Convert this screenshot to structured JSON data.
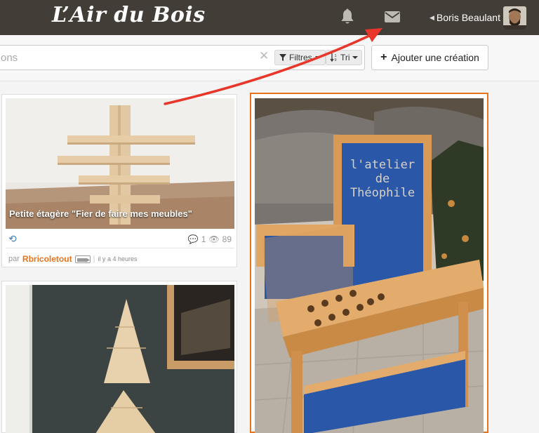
{
  "header": {
    "logo": "L’Air du Bois",
    "user_name": "Boris Beaulant",
    "icons": [
      "bell-icon",
      "envelope-icon",
      "chevron-left-icon",
      "avatar"
    ],
    "background_color": "#423d37"
  },
  "search": {
    "placeholder": "ons",
    "filters_label": "Filtres",
    "sort_label": "Tri"
  },
  "add_button": {
    "label": "Ajouter une création"
  },
  "cards": [
    {
      "title": "Petite étagère \"Fier de faire mes meubles\"",
      "comments": "1",
      "views": "89",
      "by_prefix": "par",
      "author": "Rbricoletout",
      "time": "il y a 4 heures"
    },
    {
      "title": ""
    },
    {
      "title": "",
      "highlighted": true
    }
  ],
  "colors": {
    "accent": "#e8731d",
    "link": "#3b7bbf",
    "annotation_arrow": "#e8362b"
  }
}
